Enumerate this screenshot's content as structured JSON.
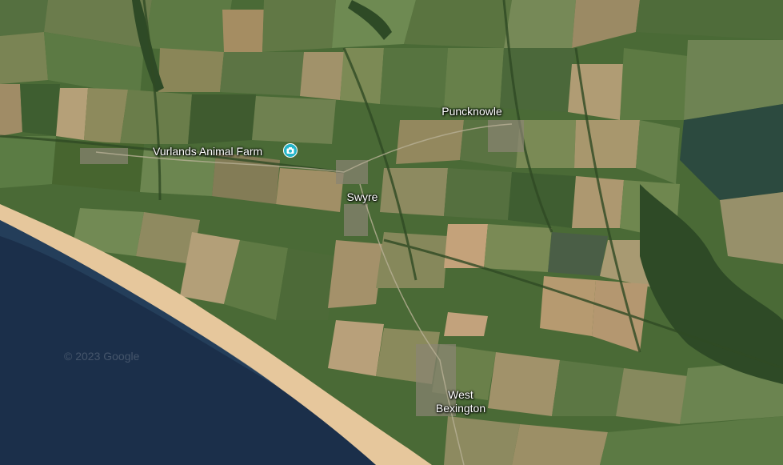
{
  "map": {
    "view": "satellite",
    "colors": {
      "sea": "#1b2f4a",
      "sea_shallow": "#2c4a66",
      "beach": "#e6c79c",
      "grass": "#4a6a36",
      "field_light": "#7e8a58",
      "field_tan": "#a7946a",
      "hedge": "#2f4a24",
      "poi_accent": "#25b4c8"
    }
  },
  "places": [
    {
      "id": "puncknowle",
      "name": "Puncknowle"
    },
    {
      "id": "swyre",
      "name": "Swyre"
    },
    {
      "id": "west-bexington",
      "name_line1": "West",
      "name_line2": "Bexington"
    }
  ],
  "poi": {
    "name": "Vurlands Animal Farm",
    "icon": "camera-icon"
  },
  "watermark": "© 2023 Google"
}
